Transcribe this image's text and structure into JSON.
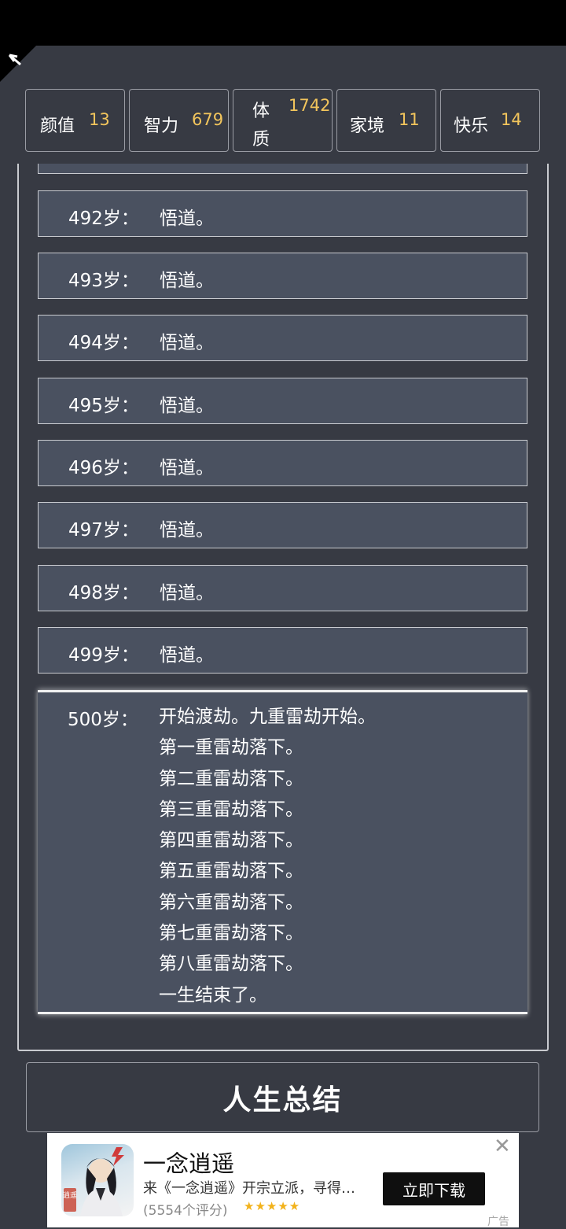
{
  "stats": [
    {
      "label": "颜值",
      "value": "13"
    },
    {
      "label": "智力",
      "value": "679"
    },
    {
      "label_line1": "体",
      "label_line2": "质",
      "value": "1742"
    },
    {
      "label": "家境",
      "value": "11"
    },
    {
      "label": "快乐",
      "value": "14"
    }
  ],
  "events": [
    {
      "age": "492岁：",
      "text": "悟道。"
    },
    {
      "age": "493岁：",
      "text": "悟道。"
    },
    {
      "age": "494岁：",
      "text": "悟道。"
    },
    {
      "age": "495岁：",
      "text": "悟道。"
    },
    {
      "age": "496岁：",
      "text": "悟道。"
    },
    {
      "age": "497岁：",
      "text": "悟道。"
    },
    {
      "age": "498岁：",
      "text": "悟道。"
    },
    {
      "age": "499岁：",
      "text": "悟道。"
    }
  ],
  "final_event": {
    "age": "500岁：",
    "lines": [
      "开始渡劫。九重雷劫开始。",
      "第一重雷劫落下。",
      "第二重雷劫落下。",
      "第三重雷劫落下。",
      "第四重雷劫落下。",
      "第五重雷劫落下。",
      "第六重雷劫落下。",
      "第七重雷劫落下。",
      "第八重雷劫落下。",
      "一生结束了。"
    ]
  },
  "summary_button": "人生总结",
  "ad": {
    "title": "一念逍遥",
    "description": "来《一念逍遥》开宗立派，寻得…",
    "rating": "(5554个评分)",
    "stars": "★★★★★",
    "cta": "立即下载",
    "close": "✕",
    "label": "广告",
    "icon_text": "逍遥"
  },
  "colors": {
    "background": "#373a43",
    "row_fill": "#4a5160",
    "stat_value": "#f2c55c"
  },
  "icons": {
    "corner": "back-arrow-icon",
    "ad_close": "close-icon"
  }
}
